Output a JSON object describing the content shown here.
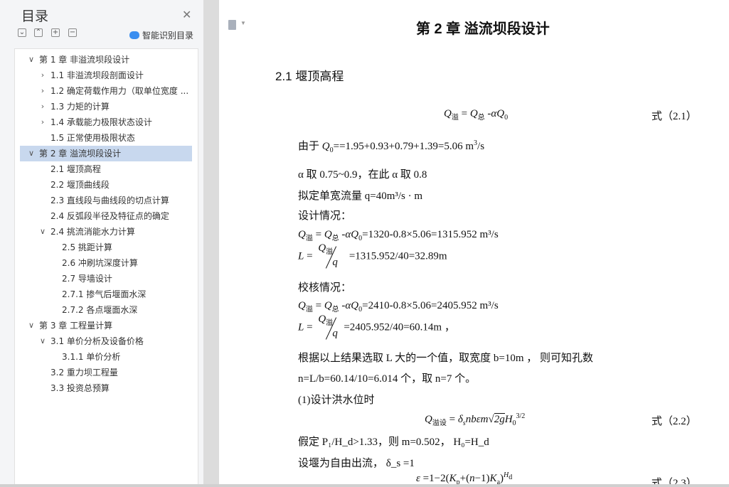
{
  "sidebar": {
    "title": "目录",
    "close_icon": "close-icon",
    "toolbar": {
      "collapse": "−",
      "expand_up": "︿",
      "add": "+",
      "remove": "−"
    },
    "smart_label": "智能识别目录",
    "toc": [
      {
        "label": "第 1 章  非溢流坝段设计",
        "level": 0,
        "toggle": "open"
      },
      {
        "label": "1.1 非溢流坝段剖面设计",
        "level": 1,
        "toggle": "closed"
      },
      {
        "label": "1.2 确定荷载作用力（取单位宽度 ...",
        "level": 1,
        "toggle": "closed"
      },
      {
        "label": "1.3 力矩的计算",
        "level": 1,
        "toggle": "closed"
      },
      {
        "label": "1.4 承载能力极限状态设计",
        "level": 1,
        "toggle": "closed"
      },
      {
        "label": "1.5 正常使用极限状态",
        "level": 1,
        "toggle": "none"
      },
      {
        "label": "第 2 章  溢流坝段设计",
        "level": 0,
        "toggle": "open",
        "selected": true
      },
      {
        "label": "2.1 堰顶高程",
        "level": 1,
        "toggle": "none"
      },
      {
        "label": "2.2 堰顶曲线段",
        "level": 1,
        "toggle": "none"
      },
      {
        "label": "2.3  直线段与曲线段的切点计算",
        "level": 1,
        "toggle": "none"
      },
      {
        "label": "2.4  反弧段半径及特征点的确定",
        "level": 1,
        "toggle": "none"
      },
      {
        "label": "2.4 挑流消能水力计算",
        "level": 1,
        "toggle": "open"
      },
      {
        "label": "2.5 挑距计算",
        "level": 2,
        "toggle": "none"
      },
      {
        "label": "2.6 冲刷坑深度计算",
        "level": 2,
        "toggle": "none"
      },
      {
        "label": "2.7 导墙设计",
        "level": 2,
        "toggle": "none"
      },
      {
        "label": "2.7.1 掺气后堰面水深",
        "level": 2,
        "toggle": "none"
      },
      {
        "label": "2.7.2 各点堰面水深",
        "level": 2,
        "toggle": "none"
      },
      {
        "label": "第 3 章  工程量计算",
        "level": 0,
        "toggle": "open"
      },
      {
        "label": "3.1  单价分析及设备价格",
        "level": 1,
        "toggle": "open"
      },
      {
        "label": "3.1.1  单价分析",
        "level": 2,
        "toggle": "none"
      },
      {
        "label": "3.2  重力坝工程量",
        "level": 1,
        "toggle": "none"
      },
      {
        "label": "3.3  投资总预算",
        "level": 1,
        "toggle": "none"
      }
    ]
  },
  "doc": {
    "chapter_title": "第 2 章  溢流坝段设计",
    "section_title": "2.1 堰顶高程",
    "eq1_label": "式（2.1）",
    "l_q0": "由于 ",
    "l_q0_val": "==1.95+0.93+0.79+1.39=5.06 m",
    "l_q0_unit": "/s",
    "l_alpha": "α 取 0.75~0.9，在此 α 取 0.8",
    "l_unitflow": "拟定单宽流量 q=40m³/s · m",
    "l_design": "设计情况：",
    "l_design_eq": "=1320-0.8×5.06=1315.952 m³/s",
    "l_design_L": "=1315.952/40=32.89m",
    "l_check": "校核情况：",
    "l_check_eq": "=2410-0.8×5.06=2405.952 m³/s",
    "l_check_L": "=2405.952/40=60.14m  ，",
    "l_choose": "根据以上结果选取 L 大的一个值，取宽度 b=10m  ，  则可知孔数",
    "l_n": "n=L/b=60.14/10=6.014 个，取 n=7 个。",
    "l_flood": "(1)设计洪水位时",
    "eq2_label": "式（2.2）",
    "l_assume": "假定 P₁/H_d>1.33，则 m=0.502，  H₀=H_d",
    "l_free": "设堰为自由出流，  δ_s =1",
    "eq3_label": "式（2.3）"
  }
}
